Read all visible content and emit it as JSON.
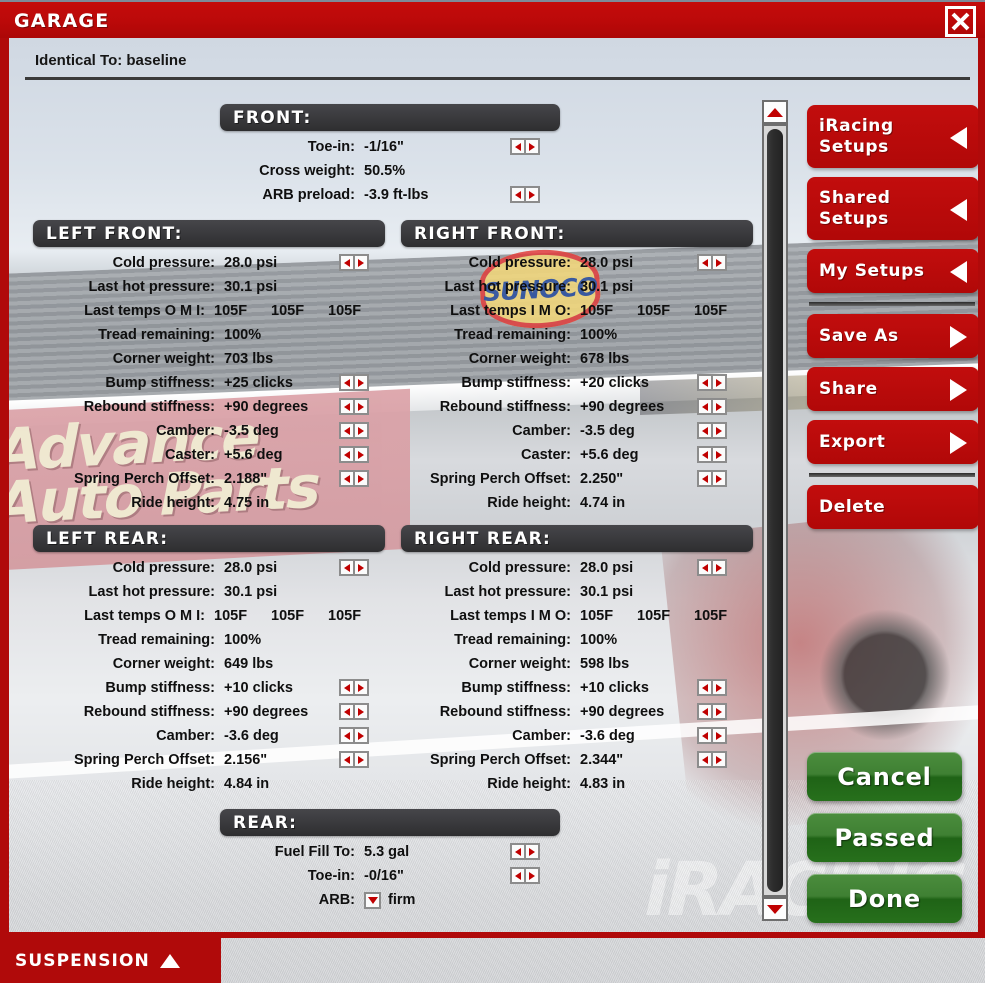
{
  "window": {
    "title": "GARAGE",
    "close_icon": "close-icon"
  },
  "header": {
    "identical_to": "Identical To: baseline"
  },
  "footer": {
    "suspension_label": "SUSPENSION",
    "suspension_arrow": "triangle-up-icon"
  },
  "sections": {
    "front": {
      "title": "FRONT:",
      "rows": [
        {
          "label": "Toe-in:",
          "value": "-1/16\"",
          "spinner": true
        },
        {
          "label": "Cross weight:",
          "value": "50.5%",
          "spinner": false
        },
        {
          "label": "ARB preload:",
          "value": "-3.9 ft-lbs",
          "spinner": true
        }
      ]
    },
    "left_front": {
      "title": "LEFT FRONT:",
      "rows": [
        {
          "label": "Cold pressure:",
          "value": "28.0 psi",
          "spinner": true
        },
        {
          "label": "Last hot pressure:",
          "value": "30.1 psi",
          "spinner": false
        },
        {
          "label": "Last temps O M I:",
          "value": "105F",
          "temps": [
            "105F",
            "105F",
            "105F"
          ],
          "spinner": false
        },
        {
          "label": "Tread remaining:",
          "value": "100%",
          "spinner": false
        },
        {
          "label": "Corner weight:",
          "value": "703 lbs",
          "spinner": false
        },
        {
          "label": "Bump stiffness:",
          "value": "+25 clicks",
          "spinner": true
        },
        {
          "label": "Rebound stiffness:",
          "value": "+90 degrees",
          "spinner": true
        },
        {
          "label": "Camber:",
          "value": "-3.5 deg",
          "spinner": true
        },
        {
          "label": "Caster:",
          "value": "+5.6 deg",
          "spinner": true
        },
        {
          "label": "Spring Perch Offset:",
          "value": "2.188\"",
          "spinner": true
        },
        {
          "label": "Ride height:",
          "value": "4.75 in",
          "spinner": false
        }
      ]
    },
    "right_front": {
      "title": "RIGHT FRONT:",
      "rows": [
        {
          "label": "Cold pressure:",
          "value": "28.0 psi",
          "spinner": true
        },
        {
          "label": "Last hot pressure:",
          "value": "30.1 psi",
          "spinner": false
        },
        {
          "label": "Last temps I M O:",
          "value": "105F",
          "temps": [
            "105F",
            "105F",
            "105F"
          ],
          "spinner": false
        },
        {
          "label": "Tread remaining:",
          "value": "100%",
          "spinner": false
        },
        {
          "label": "Corner weight:",
          "value": "678 lbs",
          "spinner": false
        },
        {
          "label": "Bump stiffness:",
          "value": "+20 clicks",
          "spinner": true
        },
        {
          "label": "Rebound stiffness:",
          "value": "+90 degrees",
          "spinner": true
        },
        {
          "label": "Camber:",
          "value": "-3.5 deg",
          "spinner": true
        },
        {
          "label": "Caster:",
          "value": "+5.6 deg",
          "spinner": true
        },
        {
          "label": "Spring Perch Offset:",
          "value": "2.250\"",
          "spinner": true
        },
        {
          "label": "Ride height:",
          "value": "4.74 in",
          "spinner": false
        }
      ]
    },
    "left_rear": {
      "title": "LEFT REAR:",
      "rows": [
        {
          "label": "Cold pressure:",
          "value": "28.0 psi",
          "spinner": true
        },
        {
          "label": "Last hot pressure:",
          "value": "30.1 psi",
          "spinner": false
        },
        {
          "label": "Last temps O M I:",
          "value": "105F",
          "temps": [
            "105F",
            "105F",
            "105F"
          ],
          "spinner": false
        },
        {
          "label": "Tread remaining:",
          "value": "100%",
          "spinner": false
        },
        {
          "label": "Corner weight:",
          "value": "649 lbs",
          "spinner": false
        },
        {
          "label": "Bump stiffness:",
          "value": "+10 clicks",
          "spinner": true
        },
        {
          "label": "Rebound stiffness:",
          "value": "+90 degrees",
          "spinner": true
        },
        {
          "label": "Camber:",
          "value": "-3.6 deg",
          "spinner": true
        },
        {
          "label": "Spring Perch Offset:",
          "value": "2.156\"",
          "spinner": true
        },
        {
          "label": "Ride height:",
          "value": "4.84 in",
          "spinner": false
        }
      ]
    },
    "right_rear": {
      "title": "RIGHT REAR:",
      "rows": [
        {
          "label": "Cold pressure:",
          "value": "28.0 psi",
          "spinner": true
        },
        {
          "label": "Last hot pressure:",
          "value": "30.1 psi",
          "spinner": false
        },
        {
          "label": "Last temps I M O:",
          "value": "105F",
          "temps": [
            "105F",
            "105F",
            "105F"
          ],
          "spinner": false
        },
        {
          "label": "Tread remaining:",
          "value": "100%",
          "spinner": false
        },
        {
          "label": "Corner weight:",
          "value": "598 lbs",
          "spinner": false
        },
        {
          "label": "Bump stiffness:",
          "value": "+10 clicks",
          "spinner": true
        },
        {
          "label": "Rebound stiffness:",
          "value": "+90 degrees",
          "spinner": true
        },
        {
          "label": "Camber:",
          "value": "-3.6 deg",
          "spinner": true
        },
        {
          "label": "Spring Perch Offset:",
          "value": "2.344\"",
          "spinner": true
        },
        {
          "label": "Ride height:",
          "value": "4.83 in",
          "spinner": false
        }
      ]
    },
    "rear": {
      "title": "REAR:",
      "rows": [
        {
          "label": "Fuel Fill To:",
          "value": "5.3 gal",
          "spinner": true
        },
        {
          "label": "Toe-in:",
          "value": "-0/16\"",
          "spinner": true
        },
        {
          "label": "ARB:",
          "value": "firm",
          "dropdown": true
        }
      ]
    }
  },
  "sidebar": {
    "items": [
      {
        "label": "iRacing Setups",
        "arrow": "triangle-left-icon"
      },
      {
        "label": "Shared Setups",
        "arrow": "triangle-left-icon"
      },
      {
        "label": "My Setups",
        "arrow": "triangle-left-icon"
      },
      {
        "label": "Save As",
        "arrow": "triangle-right-icon"
      },
      {
        "label": "Share",
        "arrow": "triangle-right-icon"
      },
      {
        "label": "Export",
        "arrow": "triangle-right-icon"
      },
      {
        "label": "Delete",
        "arrow": "none"
      }
    ]
  },
  "actions": {
    "cancel": "Cancel",
    "passed": "Passed",
    "done": "Done"
  },
  "colors": {
    "brand_red": "#b00a0a",
    "green": "#27701c",
    "header_dark": "#2e2e30",
    "spinner_red": "#c00000"
  },
  "scrollbar": {
    "up_icon": "chevron-up-icon",
    "down_icon": "chevron-down-icon"
  }
}
